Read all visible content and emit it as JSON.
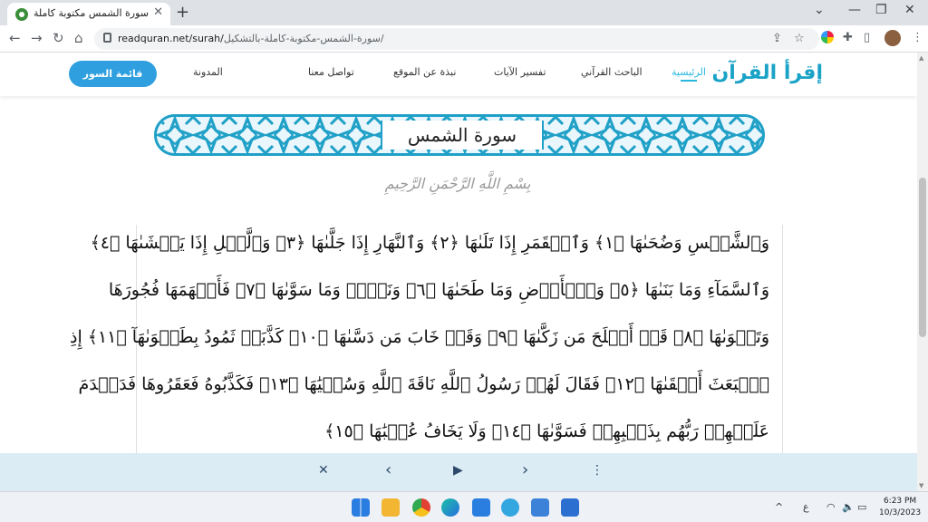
{
  "browser": {
    "tab_title": "سورة الشمس مكتوبة كاملة بالتشكيل",
    "tab_close": "✕",
    "new_tab": "+",
    "url_host": "readquran.net/surah/",
    "url_path": "سورة-الشمس-مكتوبة-كاملة-بالتشكيل/",
    "win_min": "—",
    "win_max": "❐",
    "win_close": "✕",
    "win_menu": "⌄"
  },
  "site": {
    "logo": "إقرأ القرآن",
    "nav": {
      "home": "الرئيسية",
      "search": "الباحث القرآني",
      "tafsir": "تفسير الآيات",
      "about": "نبذة عن الموقع",
      "contact": "تواصل معنا",
      "blog": "المدونة"
    },
    "surah_list_button": "قائمة السور"
  },
  "surah": {
    "title": "سورة الشمس",
    "basmala": "بِسْمِ اللَّهِ الرَّحْمَنِ الرَّحِيمِ",
    "lines": [
      "وَٱلشَّمۡسِ وَضُحَىٰهَا ﴿١﴾ وَٱلۡقَمَرِ إِذَا تَلَىٰهَا ﴿٢﴾ وَٱلنَّهَارِ إِذَا جَلَّىٰهَا ﴿٣﴾ وَٱلَّيۡلِ إِذَا يَغۡشَىٰهَا ﴿٤﴾",
      "وَٱلسَّمَآءِ وَمَا بَنَىٰهَا ﴿٥﴾ وَٱلۡأَرۡضِ وَمَا طَحَىٰهَا ﴿٦﴾ وَنَفۡسٖ وَمَا سَوَّىٰهَا ﴿٧﴾ فَأَلۡهَمَهَا فُجُورَهَا",
      "وَتَقۡوَىٰهَا ﴿٨﴾ قَدۡ أَفۡلَحَ مَن زَكَّىٰهَا ﴿٩﴾ وَقَدۡ خَابَ مَن دَسَّىٰهَا ﴿١٠﴾ كَذَّبَتۡ ثَمُودُ بِطَغۡوَىٰهَآ ﴿١١﴾ إِذِ",
      "ٱنۢبَعَثَ أَشۡقَىٰهَا ﴿١٢﴾ فَقَالَ لَهُمۡ رَسُولُ ٱللَّهِ نَاقَةَ ٱللَّهِ وَسُقۡيَٰهَا ﴿١٣﴾ فَكَذَّبُوهُ فَعَقَرُوهَا فَدَمۡدَمَ",
      "عَلَيۡهِمۡ رَبُّهُم بِذَنۢبِهِمۡ فَسَوَّىٰهَا ﴿١٤﴾ وَلَا يَخَافُ عُقۡبَٰهَا ﴿١٥﴾"
    ]
  },
  "player": {
    "close": "✕",
    "prev": "‹",
    "play": "▶",
    "next": "›",
    "menu": "⋮"
  },
  "taskbar": {
    "chevron": "^",
    "lang": "ع",
    "time": "6:23 PM",
    "date": "10/3/2023"
  },
  "colors": {
    "accent": "#1fa0c7",
    "button": "#2f9fe0",
    "player_bg": "#dcecf5"
  }
}
